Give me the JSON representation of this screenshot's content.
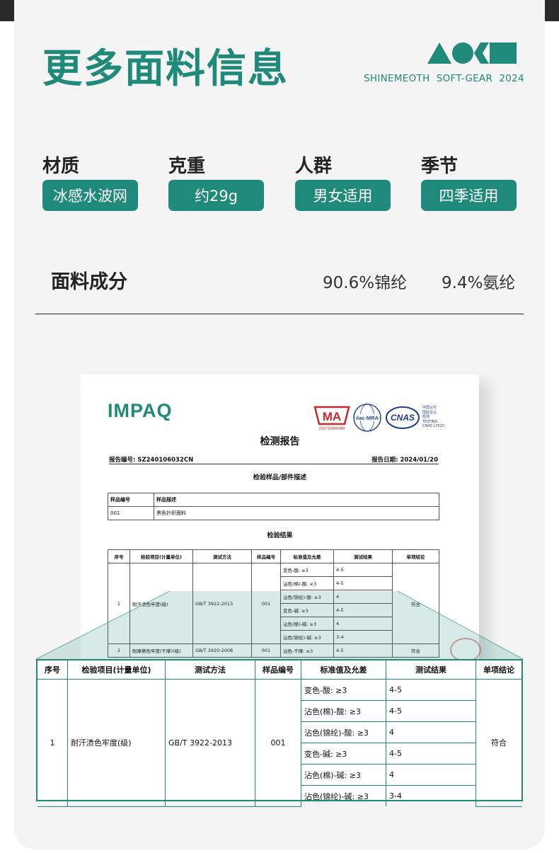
{
  "header": {
    "title": "更多面料信息",
    "brand": "SHINEMEOTH",
    "subbrand": "SOFT-GEAR",
    "year": "2024"
  },
  "colors": {
    "accent": "#1f8a7a",
    "text": "#222222",
    "background": "#f4f4f4"
  },
  "attributes": [
    {
      "label": "材质",
      "value": "冰感水波网"
    },
    {
      "label": "克重",
      "value": "约29g"
    },
    {
      "label": "人群",
      "value": "男女适用"
    },
    {
      "label": "季节",
      "value": "四季适用"
    }
  ],
  "composition": {
    "label": "面料成分",
    "values": [
      "90.6%锦纶",
      "9.4%氨纶"
    ]
  },
  "report": {
    "logo": "IMPAQ",
    "certs": [
      "MA",
      "ilac-MRA",
      "CNAS"
    ],
    "cma_number": "201719000940",
    "cnas_text": [
      "中国认可",
      "国际互认",
      "检测",
      "TESTING",
      "CNAS L7523"
    ],
    "title": "检测报告",
    "report_no": "报告编号: SZ240106032CN",
    "report_date": "报告日期: 2024/01/20",
    "sample_section": "检验样品/部件描述",
    "sample_headers": [
      "样品编号",
      "样品描述"
    ],
    "sample_row": [
      "001",
      "黑色针织面料"
    ],
    "result_section": "检验结果",
    "result_headers": [
      "序号",
      "检验项目(计量单位)",
      "测试方法",
      "样品编号",
      "标准值及允差",
      "测试结果",
      "单项结论"
    ],
    "row1": {
      "no": "1",
      "item": "耐汗渍色牢度(级)",
      "method": "GB/T 3922-2013",
      "sample": "001",
      "standards": [
        "变色-酸: ≥3",
        "沾色(棉)-酸: ≥3",
        "沾色(锦纶)-酸: ≥3",
        "变色-碱: ≥3",
        "沾色(棉)-碱: ≥3",
        "沾色(锦纶)-碱: ≥3"
      ],
      "results": [
        "4-5",
        "4-5",
        "4",
        "4-5",
        "4",
        "3-4"
      ],
      "conclusion": "符合"
    },
    "row2": {
      "no": "2",
      "item": "耐摩擦色牢度(干摩)(级)",
      "method": "GB/T 3920-2008",
      "sample": "001",
      "standard": "沾色-干摩: ≥3",
      "result": "4-5",
      "conclusion": "符合"
    }
  }
}
